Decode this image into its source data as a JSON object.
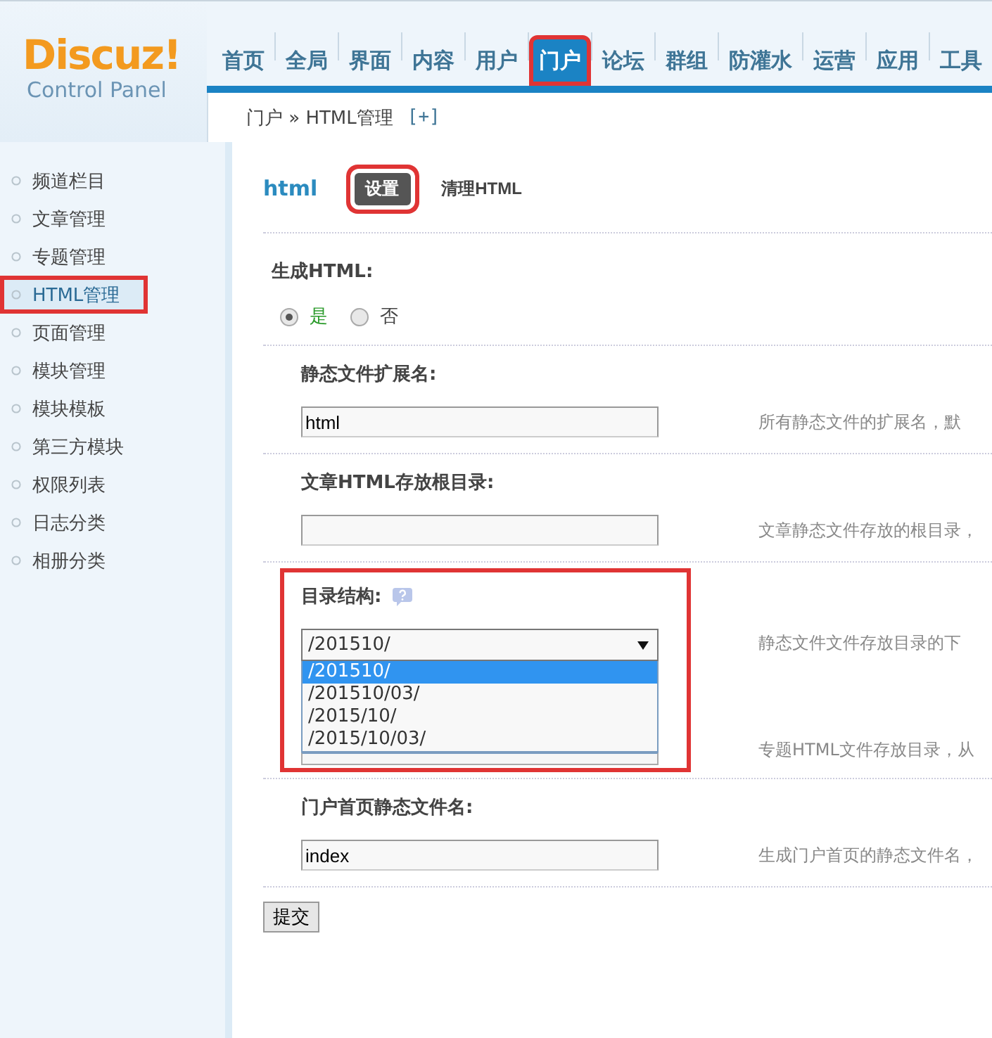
{
  "logo": {
    "brand": "Discuz!",
    "subtitle": "Control Panel"
  },
  "nav": [
    {
      "label": "首页",
      "selected": false,
      "highlighted": false
    },
    {
      "label": "全局",
      "selected": false,
      "highlighted": false
    },
    {
      "label": "界面",
      "selected": false,
      "highlighted": false
    },
    {
      "label": "内容",
      "selected": false,
      "highlighted": false
    },
    {
      "label": "用户",
      "selected": false,
      "highlighted": false
    },
    {
      "label": "门户",
      "selected": true,
      "highlighted": true
    },
    {
      "label": "论坛",
      "selected": false,
      "highlighted": false
    },
    {
      "label": "群组",
      "selected": false,
      "highlighted": false
    },
    {
      "label": "防灌水",
      "selected": false,
      "highlighted": false
    },
    {
      "label": "运营",
      "selected": false,
      "highlighted": false
    },
    {
      "label": "应用",
      "selected": false,
      "highlighted": false
    },
    {
      "label": "工具",
      "selected": false,
      "highlighted": false
    }
  ],
  "breadcrumb": {
    "path": "门户 » HTML管理",
    "add": "[+]"
  },
  "sidebar": {
    "items": [
      {
        "label": "频道栏目",
        "selected": false,
        "highlighted": false
      },
      {
        "label": "文章管理",
        "selected": false,
        "highlighted": false
      },
      {
        "label": "专题管理",
        "selected": false,
        "highlighted": false
      },
      {
        "label": "HTML管理",
        "selected": true,
        "highlighted": true
      },
      {
        "label": "页面管理",
        "selected": false,
        "highlighted": false
      },
      {
        "label": "模块管理",
        "selected": false,
        "highlighted": false
      },
      {
        "label": "模块模板",
        "selected": false,
        "highlighted": false
      },
      {
        "label": "第三方模块",
        "selected": false,
        "highlighted": false
      },
      {
        "label": "权限列表",
        "selected": false,
        "highlighted": false
      },
      {
        "label": "日志分类",
        "selected": false,
        "highlighted": false
      },
      {
        "label": "相册分类",
        "selected": false,
        "highlighted": false
      }
    ]
  },
  "page": {
    "title": "html",
    "tabs": [
      {
        "label": "设置",
        "selected": true,
        "highlighted": true
      },
      {
        "label": "清理HTML",
        "selected": false,
        "highlighted": false
      }
    ]
  },
  "form": {
    "rows": [
      {
        "kind": "radio",
        "label": "生成HTML:",
        "options": [
          {
            "label": "是",
            "selected": true
          },
          {
            "label": "否",
            "selected": false
          }
        ]
      },
      {
        "kind": "text",
        "label": "静态文件扩展名:",
        "value": "html",
        "description": "所有静态文件的扩展名，默"
      },
      {
        "kind": "text",
        "label": "文章HTML存放根目录:",
        "description": "文章静态文件存放的根目录，"
      },
      {
        "kind": "select",
        "label": "目录结构:",
        "help": true,
        "highlighted": true,
        "value": "/201510/",
        "expanded": true,
        "options": [
          {
            "label": "/201510/",
            "selected": true
          },
          {
            "label": "/201510/03/",
            "selected": false
          },
          {
            "label": "/2015/10/",
            "selected": false
          },
          {
            "label": "/2015/10/03/",
            "selected": false
          }
        ],
        "description": "静态文件文件存放目录的下",
        "covered_description": "专题HTML文件存放目录，从"
      },
      {
        "kind": "text",
        "label": "门户首页静态文件名:",
        "value": "index",
        "description": "生成门户首页的静态文件名，"
      }
    ],
    "submit": "提交"
  }
}
